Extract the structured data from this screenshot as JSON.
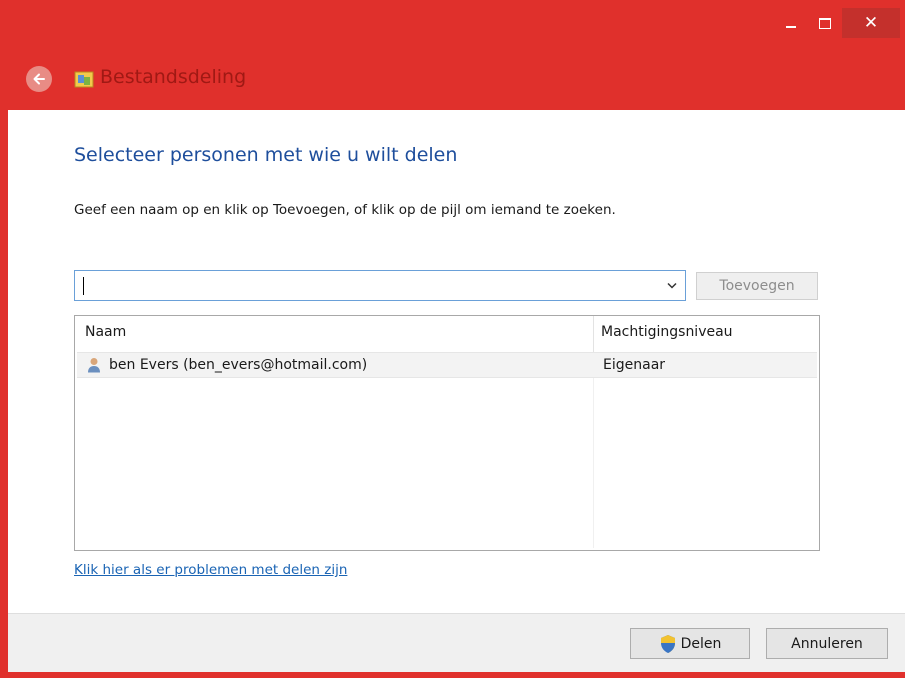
{
  "window": {
    "title": "Bestandsdeling",
    "close_symbol": "✕",
    "colors": {
      "frame": "#e0302c",
      "heading": "#1e4e9c",
      "link": "#1a64b4"
    }
  },
  "main": {
    "heading": "Selecteer personen met wie u wilt delen",
    "instruction": "Geef een naam op en klik op Toevoegen, of klik op de pijl om iemand te zoeken.",
    "name_input": {
      "value": "",
      "placeholder": ""
    },
    "add_button": "Toevoegen",
    "table": {
      "columns": [
        "Naam",
        "Machtigingsniveau"
      ],
      "rows": [
        {
          "name": "ben Evers (ben_evers@hotmail.com)",
          "permission": "Eigenaar",
          "icon": "user-icon"
        }
      ]
    },
    "help_link": "Klik hier als er problemen met delen zijn"
  },
  "footer": {
    "share_button": "Delen",
    "cancel_button": "Annuleren"
  },
  "icons": [
    "back-arrow-icon",
    "file-share-icon",
    "chevron-down-icon",
    "user-icon",
    "uac-shield-icon"
  ]
}
